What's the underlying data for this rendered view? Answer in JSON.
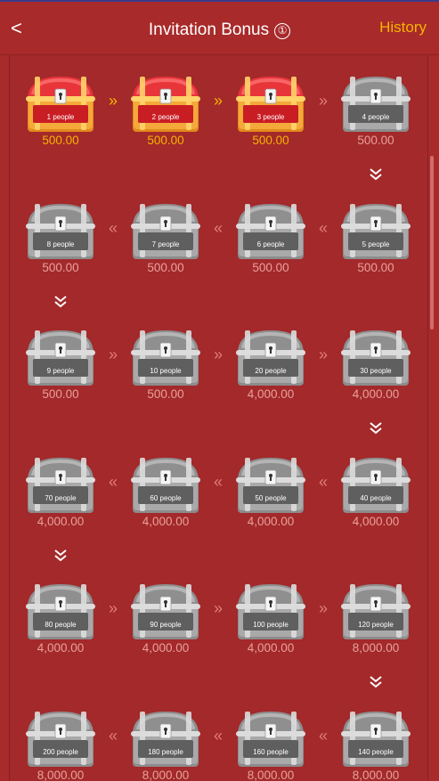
{
  "header": {
    "title": "Invitation Bonus",
    "info_symbol": "①",
    "history_label": "History",
    "back_symbol": "<"
  },
  "colors": {
    "background": "#a82a2a",
    "accent": "#f6b400",
    "inactive_text": "#e8a19a",
    "chest_active_red": "#d8262a",
    "chest_active_gold": "#f3a62a",
    "chest_inactive": "#9d9d9d"
  },
  "chests": [
    {
      "label": "1 people",
      "amount": "500.00",
      "active": true
    },
    {
      "label": "2 people",
      "amount": "500.00",
      "active": true
    },
    {
      "label": "3 people",
      "amount": "500.00",
      "active": true
    },
    {
      "label": "4 people",
      "amount": "500.00",
      "active": false
    },
    {
      "label": "5 people",
      "amount": "500.00",
      "active": false
    },
    {
      "label": "6 people",
      "amount": "500.00",
      "active": false
    },
    {
      "label": "7 people",
      "amount": "500.00",
      "active": false
    },
    {
      "label": "8 people",
      "amount": "500.00",
      "active": false
    },
    {
      "label": "9 people",
      "amount": "500.00",
      "active": false
    },
    {
      "label": "10 people",
      "amount": "500.00",
      "active": false
    },
    {
      "label": "20 people",
      "amount": "4,000.00",
      "active": false
    },
    {
      "label": "30 people",
      "amount": "4,000.00",
      "active": false
    },
    {
      "label": "40 people",
      "amount": "4,000.00",
      "active": false
    },
    {
      "label": "50 people",
      "amount": "4,000.00",
      "active": false
    },
    {
      "label": "60 people",
      "amount": "4,000.00",
      "active": false
    },
    {
      "label": "70 people",
      "amount": "4,000.00",
      "active": false
    },
    {
      "label": "80 people",
      "amount": "4,000.00",
      "active": false
    },
    {
      "label": "90 people",
      "amount": "4,000.00",
      "active": false
    },
    {
      "label": "100 people",
      "amount": "4,000.00",
      "active": false
    },
    {
      "label": "120 people",
      "amount": "8,000.00",
      "active": false
    },
    {
      "label": "140 people",
      "amount": "8,000.00",
      "active": false
    },
    {
      "label": "160 people",
      "amount": "8,000.00",
      "active": false
    },
    {
      "label": "180 people",
      "amount": "8,000.00",
      "active": false
    },
    {
      "label": "200 people",
      "amount": "8,000.00",
      "active": false
    }
  ],
  "icons": {
    "right_arrow": "»",
    "left_arrow": "«",
    "down_arrow": "chevron-double-down-icon"
  }
}
